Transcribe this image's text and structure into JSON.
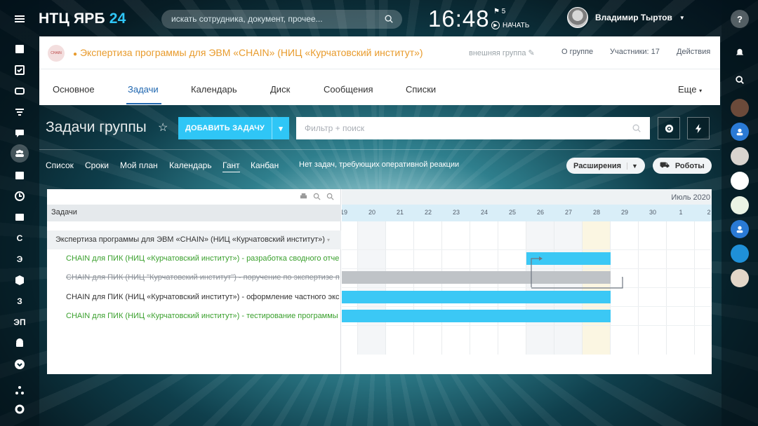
{
  "header": {
    "logo_text": "НТЦ ЯРБ",
    "logo_accent": "24",
    "search_placeholder": "искать сотрудника, документ, прочее...",
    "time": "16:48",
    "flag_count": "5",
    "start_label": "НАЧАТЬ",
    "user_name": "Владимир Тыртов"
  },
  "left_rail": {
    "letters": [
      "С",
      "Э",
      "З",
      "ЭП"
    ]
  },
  "group": {
    "title": "Экспертиза программы для ЭВМ «CHAIN» (НИЦ «Курчатовский институт»)",
    "external_label": "внешняя группа",
    "about": "О группе",
    "members": "Участники: 17",
    "actions": "Действия"
  },
  "tabs": [
    "Основное",
    "Задачи",
    "Календарь",
    "Диск",
    "Сообщения",
    "Списки"
  ],
  "tabs_more": "Еще",
  "toolbar": {
    "page_title": "Задачи группы",
    "add_task": "ДОБАВИТЬ ЗАДАЧУ",
    "filter_placeholder": "Фильтр + поиск"
  },
  "views": [
    "Список",
    "Сроки",
    "Мой план",
    "Календарь",
    "Гант",
    "Канбан"
  ],
  "no_tasks_text": "Нет задач, требующих оперативной реакции",
  "extensions_label": "Расширения",
  "robots_label": "Роботы",
  "gantt": {
    "tasks_header": "Задачи",
    "month_label": "Июль 2020",
    "days": [
      "19",
      "20",
      "21",
      "22",
      "23",
      "24",
      "25",
      "26",
      "27",
      "28",
      "29",
      "30",
      "1",
      "2"
    ],
    "project_row": "Экспертиза программы для ЭВМ «CHAIN» (НИЦ «Курчатовский институт»)",
    "tasks": [
      {
        "name": "CHAIN для ПИК (НИЦ «Курчатовский институт») - разработка сводного отче",
        "style": "green"
      },
      {
        "name": "CHAIN для ПИК (НИЦ \"Курчатовский институт\") - поручение по экспертизе п",
        "style": "struck"
      },
      {
        "name": "CHAIN для ПИК (НИЦ «Курчатовский институт») - оформление частного экс",
        "style": "dark"
      },
      {
        "name": "CHAIN для ПИК (НИЦ «Курчатовский институт») - тестирование программы",
        "style": "green"
      }
    ],
    "colors": {
      "bar": "#3bc8f5",
      "completed_bar": "#bfc3c7",
      "today": "#fbf6e2"
    }
  }
}
